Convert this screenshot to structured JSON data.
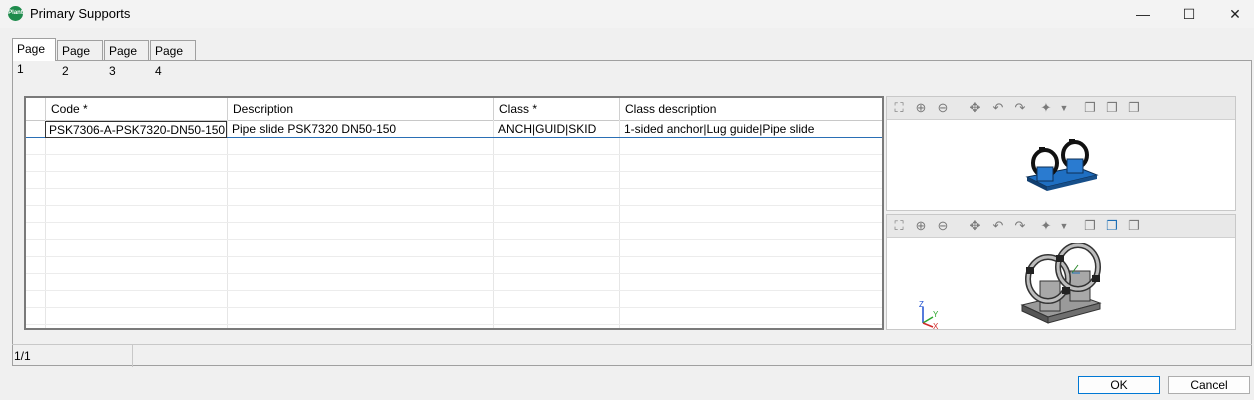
{
  "window": {
    "app_icon_text": "Plant",
    "title": "Primary Supports",
    "minimize_glyph": "—",
    "maximize_glyph": "☐",
    "close_glyph": "✕"
  },
  "tabs": [
    {
      "label": "Page 1",
      "active": true
    },
    {
      "label": "Page 2",
      "active": false
    },
    {
      "label": "Page 3",
      "active": false
    },
    {
      "label": "Page 4",
      "active": false
    }
  ],
  "grid": {
    "columns": [
      "Code *",
      "Description",
      "Class *",
      "Class description"
    ],
    "rows": [
      [
        "PSK7306-A-PSK7320-DN50-150",
        "Pipe slide PSK7320 DN50-150",
        "ANCH|GUID|SKID",
        "1-sided anchor|Lug guide|Pipe slide"
      ]
    ]
  },
  "viewer_toolbar": {
    "icons": [
      "zoom-extents-icon",
      "zoom-in-icon",
      "zoom-out-icon",
      "pan-icon",
      "rotate-left-icon",
      "rotate-right-icon",
      "view-point-icon",
      "dropdown-arrow-icon",
      "shade-1-icon",
      "shade-2-icon",
      "shade-3-icon"
    ]
  },
  "axis_labels": {
    "z": "Z",
    "y": "Y",
    "x": "X"
  },
  "status": {
    "count": "1/1"
  },
  "buttons": {
    "ok": "OK",
    "cancel": "Cancel"
  },
  "colors": {
    "accent": "#1e6fb5",
    "selection_blue": "#2a6fb5",
    "app_icon": "#1e8b4c"
  }
}
